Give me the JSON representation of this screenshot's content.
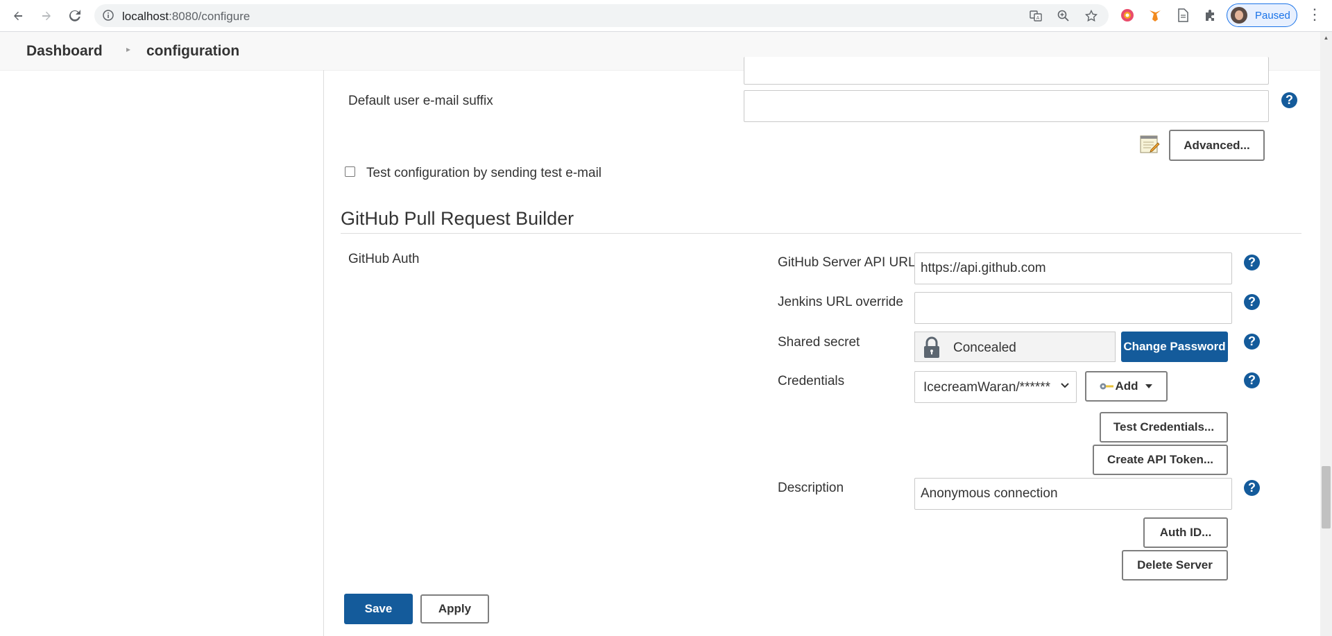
{
  "browser": {
    "url_host": "localhost",
    "url_path": ":8080/configure",
    "profile_status": "Paused"
  },
  "breadcrumb": {
    "items": [
      "Dashboard",
      "configuration"
    ]
  },
  "email": {
    "default_suffix_label": "Default user e-mail suffix",
    "default_suffix_value": "",
    "advanced_label": "Advanced...",
    "test_config_label": "Test configuration by sending test e-mail",
    "test_config_checked": false
  },
  "github_prb": {
    "section_title": "GitHub Pull Request Builder",
    "auth_label": "GitHub Auth",
    "server_api_url_label": "GitHub Server API URL",
    "server_api_url_value": "https://api.github.com",
    "jenkins_url_override_label": "Jenkins URL override",
    "jenkins_url_override_value": "",
    "shared_secret_label": "Shared secret",
    "shared_secret_value": "Concealed",
    "change_password_label": "Change Password",
    "credentials_label": "Credentials",
    "credentials_value": "IcecreamWaran/******",
    "add_label": "Add",
    "test_credentials_label": "Test Credentials...",
    "create_api_token_label": "Create API Token...",
    "description_label": "Description",
    "description_value": "Anonymous connection",
    "auth_id_label": "Auth ID...",
    "delete_server_label": "Delete Server"
  },
  "footer": {
    "save_label": "Save",
    "apply_label": "Apply"
  },
  "colors": {
    "primary": "#145b9b",
    "help_icon": "#145b9b"
  }
}
